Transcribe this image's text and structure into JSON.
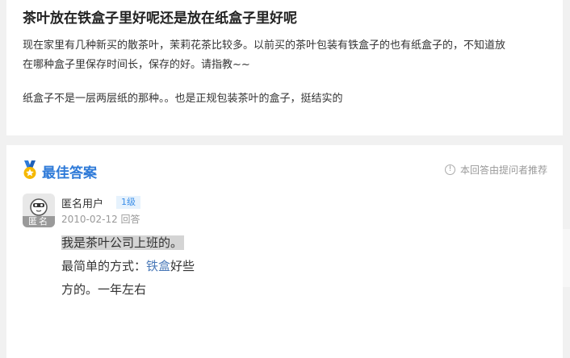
{
  "question": {
    "title": "茶叶放在铁盒子里好呢还是放在纸盒子里好呢",
    "body_line_1a": "现在家里有几种新买的散茶叶，茉莉花茶比较多。以前买的茶叶包装有铁盒子的也有纸盒子的，不知道放",
    "body_line_1b": "在哪种盒子里保存时间长，保存的好。请指教~~",
    "body_line_2": "纸盒子不是一层两层纸的那种。。也是正规包装茶叶的盒子，挺结实的"
  },
  "best_answer": {
    "label": "最佳答案",
    "recommend_note": "本回答由提问者推荐",
    "icons": {
      "medal": "best-answer-medal-icon",
      "info": "info-circle-icon"
    },
    "colors": {
      "accent": "#2e7ad8",
      "medal": "#f5b800",
      "link": "#4a79b8"
    }
  },
  "answerer": {
    "avatar_badge": "匿名",
    "name": "匿名用户",
    "level": "1级",
    "date": "2010-02-12 回答"
  },
  "answer": {
    "line_1": "我是茶叶公司上班的。",
    "line_2_prefix": "最简单的方式：",
    "line_2_link": "铁盒",
    "line_2_suffix": "好些",
    "line_3": "方的。一年左右"
  }
}
